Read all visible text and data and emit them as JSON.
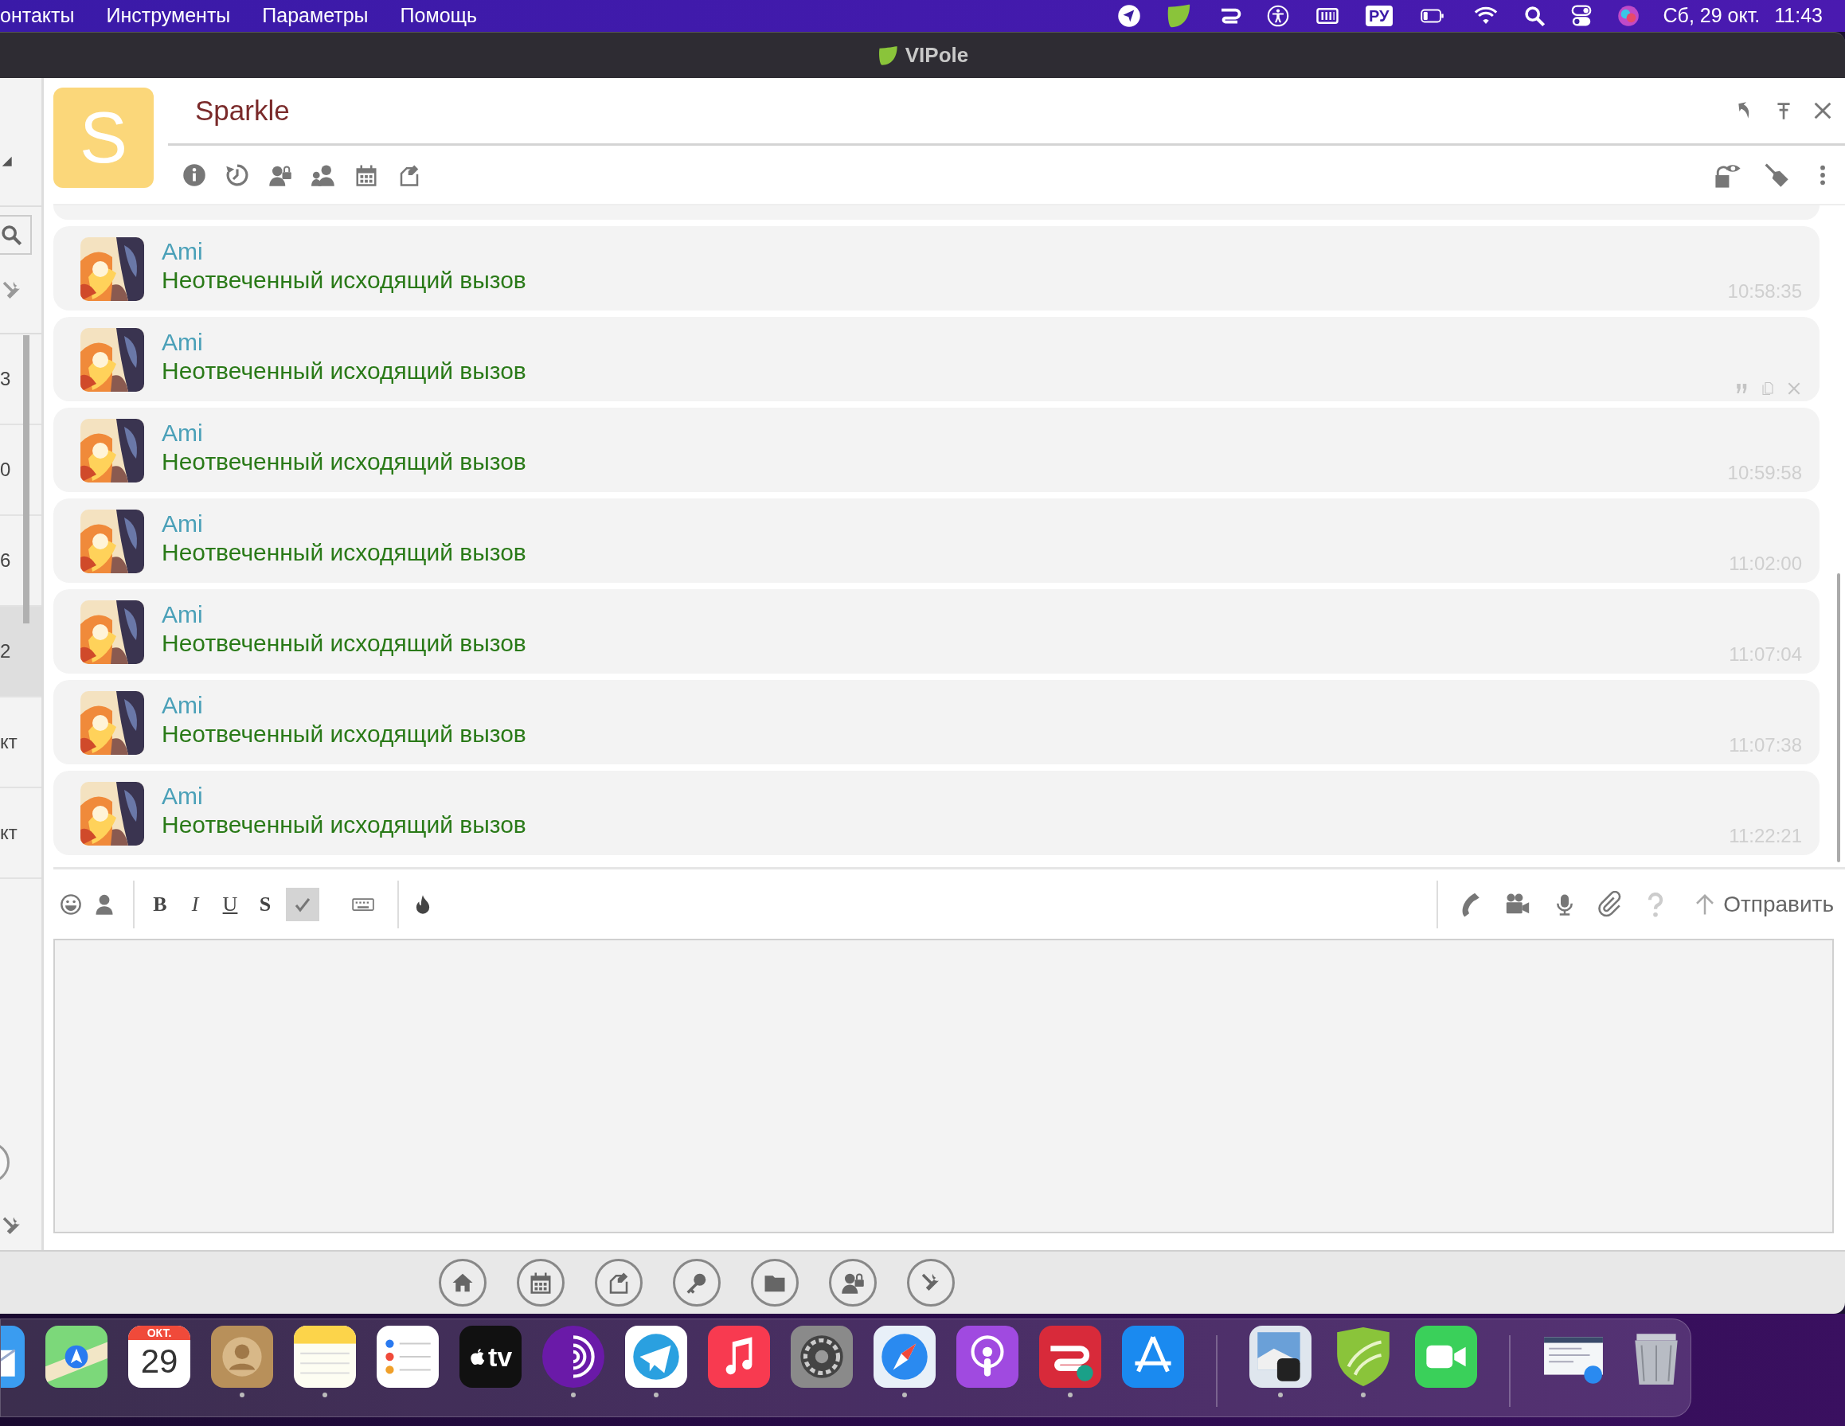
{
  "menu_bar": {
    "menus": [
      "онтакты",
      "Инструменты",
      "Параметры",
      "Помощь"
    ],
    "input_source": "РУ",
    "date": "Сб, 29 окт.",
    "time": "11:43"
  },
  "window": {
    "title": "VIPole"
  },
  "sidebar": {
    "items": [
      {
        "text": "3",
        "selected": false
      },
      {
        "text": "0",
        "selected": false
      },
      {
        "text": "6",
        "selected": false
      },
      {
        "text": "2",
        "selected": true
      },
      {
        "text": "кт",
        "selected": false
      },
      {
        "text": "кт",
        "selected": false
      }
    ]
  },
  "chat": {
    "contact": {
      "initial": "S",
      "name": "Sparkle"
    },
    "messages": [
      {
        "sender": "Ami",
        "text": "Неотвеченный исходящий вызов",
        "time": "10:58:35",
        "hovered": false
      },
      {
        "sender": "Ami",
        "text": "Неотвеченный исходящий вызов",
        "hovered": true
      },
      {
        "sender": "Ami",
        "text": "Неотвеченный исходящий вызов",
        "time": "10:59:58",
        "hovered": false
      },
      {
        "sender": "Ami",
        "text": "Неотвеченный исходящий вызов",
        "time": "11:02:00",
        "hovered": false
      },
      {
        "sender": "Ami",
        "text": "Неотвеченный исходящий вызов",
        "time": "11:07:04",
        "hovered": false
      },
      {
        "sender": "Ami",
        "text": "Неотвеченный исходящий вызов",
        "time": "11:07:38",
        "hovered": false
      },
      {
        "sender": "Ami",
        "text": "Неотвеченный исходящий вызов",
        "time": "11:22:21",
        "hovered": false
      }
    ]
  },
  "composer": {
    "format_buttons": [
      {
        "kind": "bold",
        "label": "B"
      },
      {
        "kind": "italic",
        "label": "I"
      },
      {
        "kind": "underline",
        "label": "U"
      },
      {
        "kind": "strike",
        "label": "S"
      }
    ],
    "spellcheck_on": true,
    "send_label": "Отправить"
  },
  "dock": {
    "items": [
      {
        "kind": "mail",
        "running": false
      },
      {
        "kind": "maps",
        "running": false
      },
      {
        "kind": "calendar",
        "month": "ОКТ.",
        "day": "29",
        "running": false
      },
      {
        "kind": "contacts",
        "running": true
      },
      {
        "kind": "notes",
        "running": true
      },
      {
        "kind": "reminders",
        "running": false
      },
      {
        "kind": "tv",
        "label": "tv",
        "running": false
      },
      {
        "kind": "tor",
        "running": true
      },
      {
        "kind": "telegram",
        "running": true
      },
      {
        "kind": "music",
        "running": false
      },
      {
        "kind": "settings",
        "running": false
      },
      {
        "kind": "safari",
        "running": true
      },
      {
        "kind": "podcasts",
        "running": false
      },
      {
        "kind": "vpn",
        "running": true
      },
      {
        "kind": "appstore",
        "running": false
      },
      {
        "kind": "separator"
      },
      {
        "kind": "preview",
        "running": true
      },
      {
        "kind": "shield",
        "running": true
      },
      {
        "kind": "facetime",
        "running": false
      },
      {
        "kind": "separator"
      },
      {
        "kind": "window",
        "running": false
      },
      {
        "kind": "trash",
        "running": false
      }
    ]
  }
}
